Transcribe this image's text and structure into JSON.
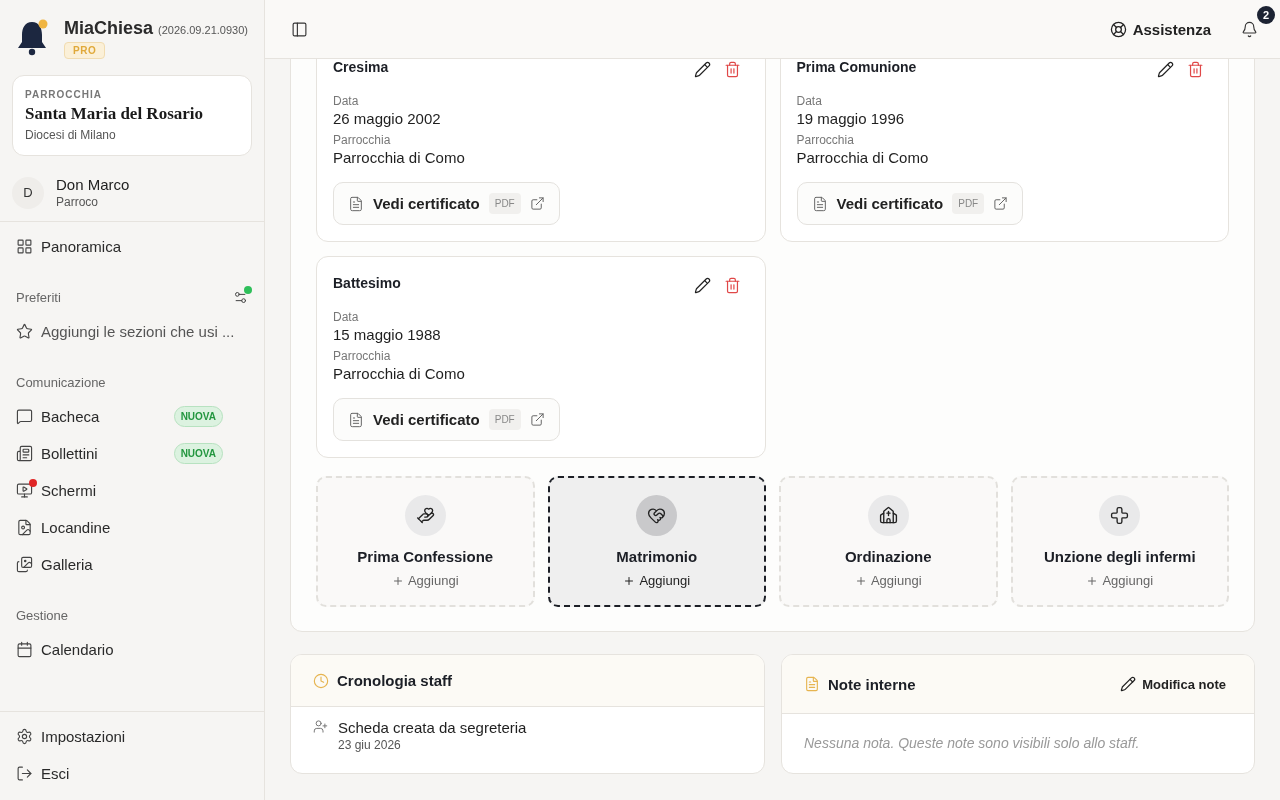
{
  "app": {
    "name": "MiaChiesa",
    "version": "(2026.09.21.0930)",
    "plan": "PRO"
  },
  "parish": {
    "label": "PARROCCHIA",
    "name": "Santa Maria del Rosario",
    "diocese": "Diocesi di Milano"
  },
  "user": {
    "initial": "D",
    "name": "Don Marco",
    "role": "Parroco"
  },
  "nav_top": [
    {
      "label": "Panoramica"
    }
  ],
  "nav_sections": [
    {
      "title": "Preferiti",
      "notice": true,
      "items": [
        {
          "label": "Aggiungi le sezioni che usi ...",
          "kind": "hint",
          "alert": false
        }
      ]
    },
    {
      "title": "Comunicazione",
      "items": [
        {
          "label": "Bacheca",
          "kind": "link",
          "badge": "NUOVA",
          "alert": false
        },
        {
          "label": "Bollettini",
          "kind": "link",
          "badge": "NUOVA",
          "alert": false
        },
        {
          "label": "Schermi",
          "kind": "link",
          "alert": true
        },
        {
          "label": "Locandine",
          "kind": "link",
          "alert": false
        },
        {
          "label": "Galleria",
          "kind": "link",
          "alert": false
        }
      ]
    },
    {
      "title": "Gestione",
      "items": [
        {
          "label": "Calendario",
          "kind": "link",
          "alert": false
        }
      ]
    }
  ],
  "nav_footer": [
    {
      "label": "Impostazioni"
    },
    {
      "label": "Esci"
    }
  ],
  "header": {
    "help": "Assistenza",
    "notifications": "2"
  },
  "records": [
    {
      "title": "Cresima",
      "date_label": "Data",
      "date": "26 maggio 2002",
      "parish_label": "Parrocchia",
      "parish": "Parrocchia di Como",
      "certificate": "Vedi certificato",
      "format": "PDF"
    },
    {
      "title": "Prima Comunione",
      "date_label": "Data",
      "date": "19 maggio 1996",
      "parish_label": "Parrocchia",
      "parish": "Parrocchia di Como",
      "certificate": "Vedi certificato",
      "format": "PDF"
    },
    {
      "title": "Battesimo",
      "date_label": "Data",
      "date": "15 maggio 1988",
      "parish_label": "Parrocchia",
      "parish": "Parrocchia di Como",
      "certificate": "Vedi certificato",
      "format": "PDF"
    }
  ],
  "add_cards": [
    {
      "title": "Prima Confessione",
      "action": "Aggiungi",
      "selected": false
    },
    {
      "title": "Matrimonio",
      "action": "Aggiungi",
      "selected": true
    },
    {
      "title": "Ordinazione",
      "action": "Aggiungi",
      "selected": false
    },
    {
      "title": "Unzione degli infermi",
      "action": "Aggiungi",
      "selected": false
    }
  ],
  "timeline": {
    "title": "Cronologia staff",
    "entries": [
      {
        "text": "Scheda creata da segreteria",
        "date": "23 giu 2026"
      }
    ]
  },
  "notes": {
    "title": "Note interne",
    "edit": "Modifica note",
    "empty": "Nessuna nota. Queste note sono visibili solo allo staff."
  }
}
